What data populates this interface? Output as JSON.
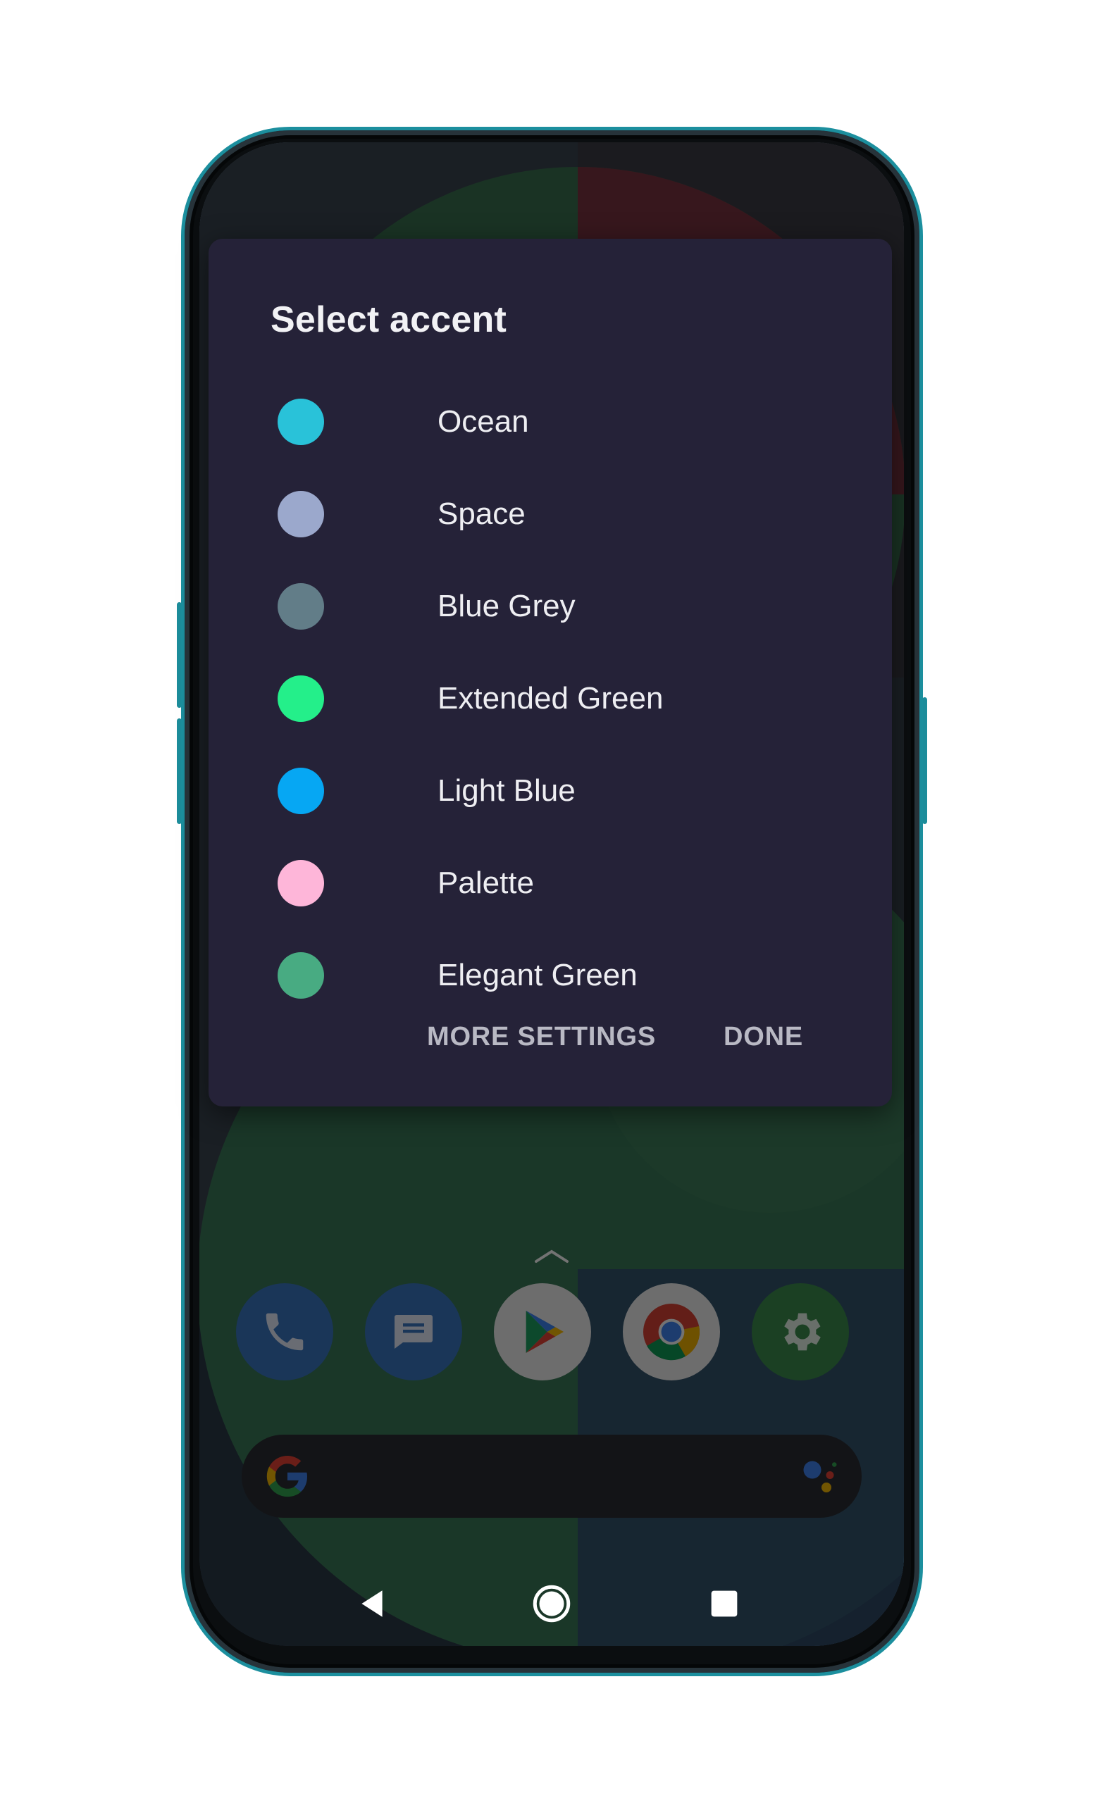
{
  "dialog": {
    "title": "Select accent",
    "options": [
      {
        "label": "Ocean",
        "color": "#29c2d9"
      },
      {
        "label": "Space",
        "color": "#9ba8cc"
      },
      {
        "label": "Blue Grey",
        "color": "#627d88"
      },
      {
        "label": "Extended Green",
        "color": "#24ef8a"
      },
      {
        "label": "Light Blue",
        "color": "#06a7f3"
      },
      {
        "label": "Palette",
        "color": "#feb6d9"
      },
      {
        "label": "Elegant Green",
        "color": "#48ab82"
      }
    ],
    "actions": {
      "more_settings": "MORE SETTINGS",
      "done": "DONE"
    }
  },
  "home": {
    "dock_icons": [
      "phone-icon",
      "messages-icon",
      "play-store-icon",
      "chrome-icon",
      "settings-icon"
    ]
  },
  "nav": {
    "icons": [
      "back-icon",
      "home-icon",
      "recents-icon"
    ]
  }
}
